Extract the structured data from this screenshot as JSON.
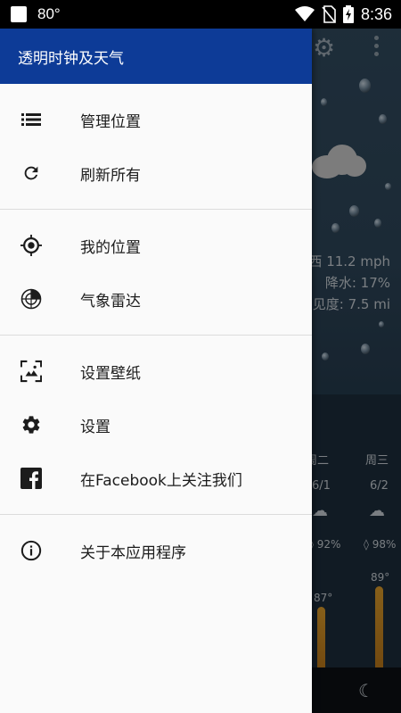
{
  "status_bar": {
    "temperature": "80°",
    "time": "8:36"
  },
  "background_app": {
    "wind": "西 11.2 mph",
    "precipitation": "降水: 17%",
    "visibility": "见度: 7.5 mi",
    "forecast": [
      {
        "day": "周二",
        "date": "6/1",
        "humidity": "92%",
        "high": "87°"
      },
      {
        "day": "周三",
        "date": "6/2",
        "humidity": "98%",
        "high": "89°"
      }
    ]
  },
  "drawer": {
    "title": "透明时钟及天气",
    "sections": [
      [
        {
          "id": "manage-locations",
          "label": "管理位置",
          "icon": "list-icon"
        },
        {
          "id": "refresh-all",
          "label": "刷新所有",
          "icon": "refresh-icon"
        }
      ],
      [
        {
          "id": "my-location",
          "label": "我的位置",
          "icon": "gps-target-icon"
        },
        {
          "id": "weather-radar",
          "label": "气象雷达",
          "icon": "radar-icon"
        }
      ],
      [
        {
          "id": "set-wallpaper",
          "label": "设置壁纸",
          "icon": "wallpaper-icon"
        },
        {
          "id": "settings",
          "label": "设置",
          "icon": "gear-icon"
        },
        {
          "id": "facebook",
          "label": "在Facebook上关注我们",
          "icon": "facebook-icon"
        }
      ],
      [
        {
          "id": "about",
          "label": "关于本应用程序",
          "icon": "info-icon"
        }
      ]
    ]
  },
  "colors": {
    "drawer_header": "#0d3b97",
    "drawer_bg": "#fafafa",
    "icon": "#1c1c1c",
    "rain_bar": "#c9841f"
  }
}
